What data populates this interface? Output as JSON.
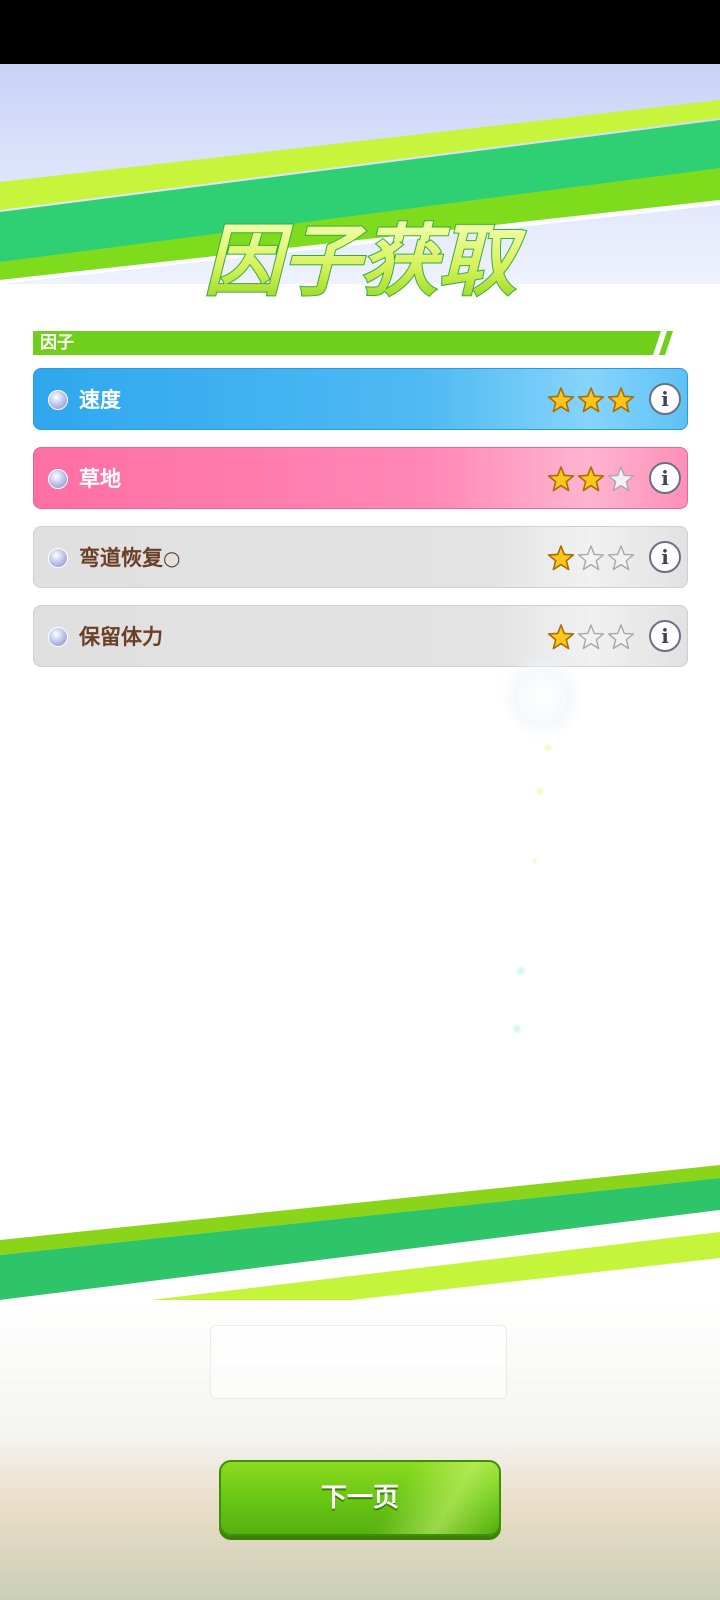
{
  "screen": {
    "title": "因子获取",
    "section_label": "因子"
  },
  "factors": [
    {
      "name": "速度",
      "suffix": "",
      "stars_filled": 3,
      "stars_total": 3,
      "color": "blue"
    },
    {
      "name": "草地",
      "suffix": "",
      "stars_filled": 2,
      "stars_total": 3,
      "color": "pink"
    },
    {
      "name": "弯道恢复",
      "suffix": "○",
      "stars_filled": 1,
      "stars_total": 3,
      "color": "gray"
    },
    {
      "name": "保留体力",
      "suffix": "",
      "stars_filled": 1,
      "stars_total": 3,
      "color": "gray"
    }
  ],
  "info_glyph": "i",
  "next_button": {
    "label": "下一页"
  },
  "colors": {
    "accent_green": "#6fcf1a",
    "stripe_teal": "#2ecc71",
    "star_gold": "#ffc61a",
    "row_blue": "#2fa7ee",
    "row_pink": "#ff6fa3",
    "row_gray": "#e0e0e0"
  },
  "icons": [
    "info-icon",
    "star-icon",
    "bullet-dot-icon"
  ]
}
